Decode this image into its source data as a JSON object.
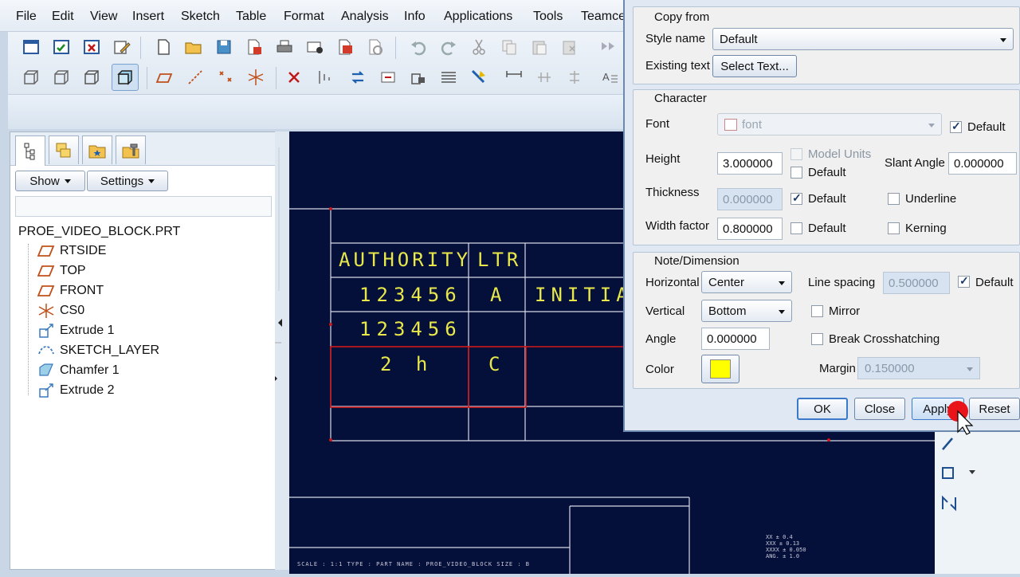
{
  "menu": [
    "File",
    "Edit",
    "View",
    "Insert",
    "Sketch",
    "Table",
    "Format",
    "Analysis",
    "Info",
    "Applications",
    "Tools",
    "Teamce"
  ],
  "icons": {
    "toolbar_row1": [
      "window-icon",
      "check-window-icon",
      "close-window-icon",
      "edit-window-icon",
      "new-file-icon",
      "open-folder-icon",
      "save-icon",
      "save-copy-icon",
      "print-icon",
      "mail-icon",
      "pdf-icon",
      "plot-icon",
      "undo-icon",
      "redo-icon",
      "cut-icon",
      "copy-icon",
      "paste-icon",
      "paste-special-icon",
      "regenerate-icon"
    ],
    "toolbar_row2": [
      "wireframe-view-icon",
      "hidden-line-icon",
      "no-hidden-icon",
      "shaded-view-icon",
      "datum-plane-icon",
      "datum-axis-icon",
      "datum-point-icon",
      "csys-icon",
      "delete-icon",
      "sort-icon",
      "refresh-icon",
      "move-icon",
      "lock-icon",
      "table-icon",
      "repeat-region-icon",
      "dimension-icon",
      "align-icon",
      "text-style-icon"
    ]
  },
  "model_tree": {
    "show_label": "Show",
    "settings_label": "Settings",
    "root": "PROE_VIDEO_BLOCK.PRT",
    "items": [
      {
        "label": "RTSIDE",
        "icon": "datum-plane-icon"
      },
      {
        "label": "TOP",
        "icon": "datum-plane-icon"
      },
      {
        "label": "FRONT",
        "icon": "datum-plane-icon"
      },
      {
        "label": "CS0",
        "icon": "csys-icon"
      },
      {
        "label": "Extrude 1",
        "icon": "extrude-icon"
      },
      {
        "label": "SKETCH_LAYER",
        "icon": "sketch-icon"
      },
      {
        "label": "Chamfer 1",
        "icon": "chamfer-icon"
      },
      {
        "label": "Extrude 2",
        "icon": "extrude-icon"
      }
    ]
  },
  "drawing_table": {
    "row1": [
      "AUTHORITY",
      "LTR"
    ],
    "row2": [
      "123456",
      "A",
      "INITIAL"
    ],
    "row3": [
      "123456"
    ],
    "row4": [
      "2 h",
      "C"
    ]
  },
  "drawing_footer": "SCALE : 1:1     TYPE : PART     NAME : PROE_VIDEO_BLOCK     SIZE : B",
  "tolerances": [
    "XX  ± 0.4",
    "XXX  ± 0.13",
    "XXXX  ± 0.050",
    "ANG.  ± 1.0"
  ],
  "dialog": {
    "copy_from": {
      "title": "Copy from",
      "style_name_label": "Style name",
      "style_name_value": "Default",
      "existing_text_label": "Existing text",
      "select_text_button": "Select Text..."
    },
    "character": {
      "title": "Character",
      "font_label": "Font",
      "font_value": "font",
      "font_default_label": "Default",
      "height_label": "Height",
      "height_value": "3.000000",
      "model_units_label": "Model Units",
      "height_default_label": "Default",
      "slant_angle_label": "Slant Angle",
      "slant_angle_value": "0.000000",
      "thickness_label": "Thickness",
      "thickness_value": "0.000000",
      "thickness_default_label": "Default",
      "underline_label": "Underline",
      "width_factor_label": "Width factor",
      "width_factor_value": "0.800000",
      "width_default_label": "Default",
      "kerning_label": "Kerning"
    },
    "note_dimension": {
      "title": "Note/Dimension",
      "horizontal_label": "Horizontal",
      "horizontal_value": "Center",
      "line_spacing_label": "Line spacing",
      "line_spacing_value": "0.500000",
      "line_spacing_default_label": "Default",
      "vertical_label": "Vertical",
      "vertical_value": "Bottom",
      "mirror_label": "Mirror",
      "angle_label": "Angle",
      "angle_value": "0.000000",
      "break_crosshatching_label": "Break Crosshatching",
      "color_label": "Color",
      "color_value": "#ffff00",
      "margin_label": "Margin",
      "margin_value": "0.150000"
    },
    "buttons": {
      "ok": "OK",
      "close": "Close",
      "apply": "Apply",
      "reset": "Reset"
    }
  },
  "colors": {
    "canvas_bg": "#05103a",
    "table_line": "#d8d8e8",
    "highlight": "#d01818",
    "text_yellow": "#e8e84a"
  }
}
